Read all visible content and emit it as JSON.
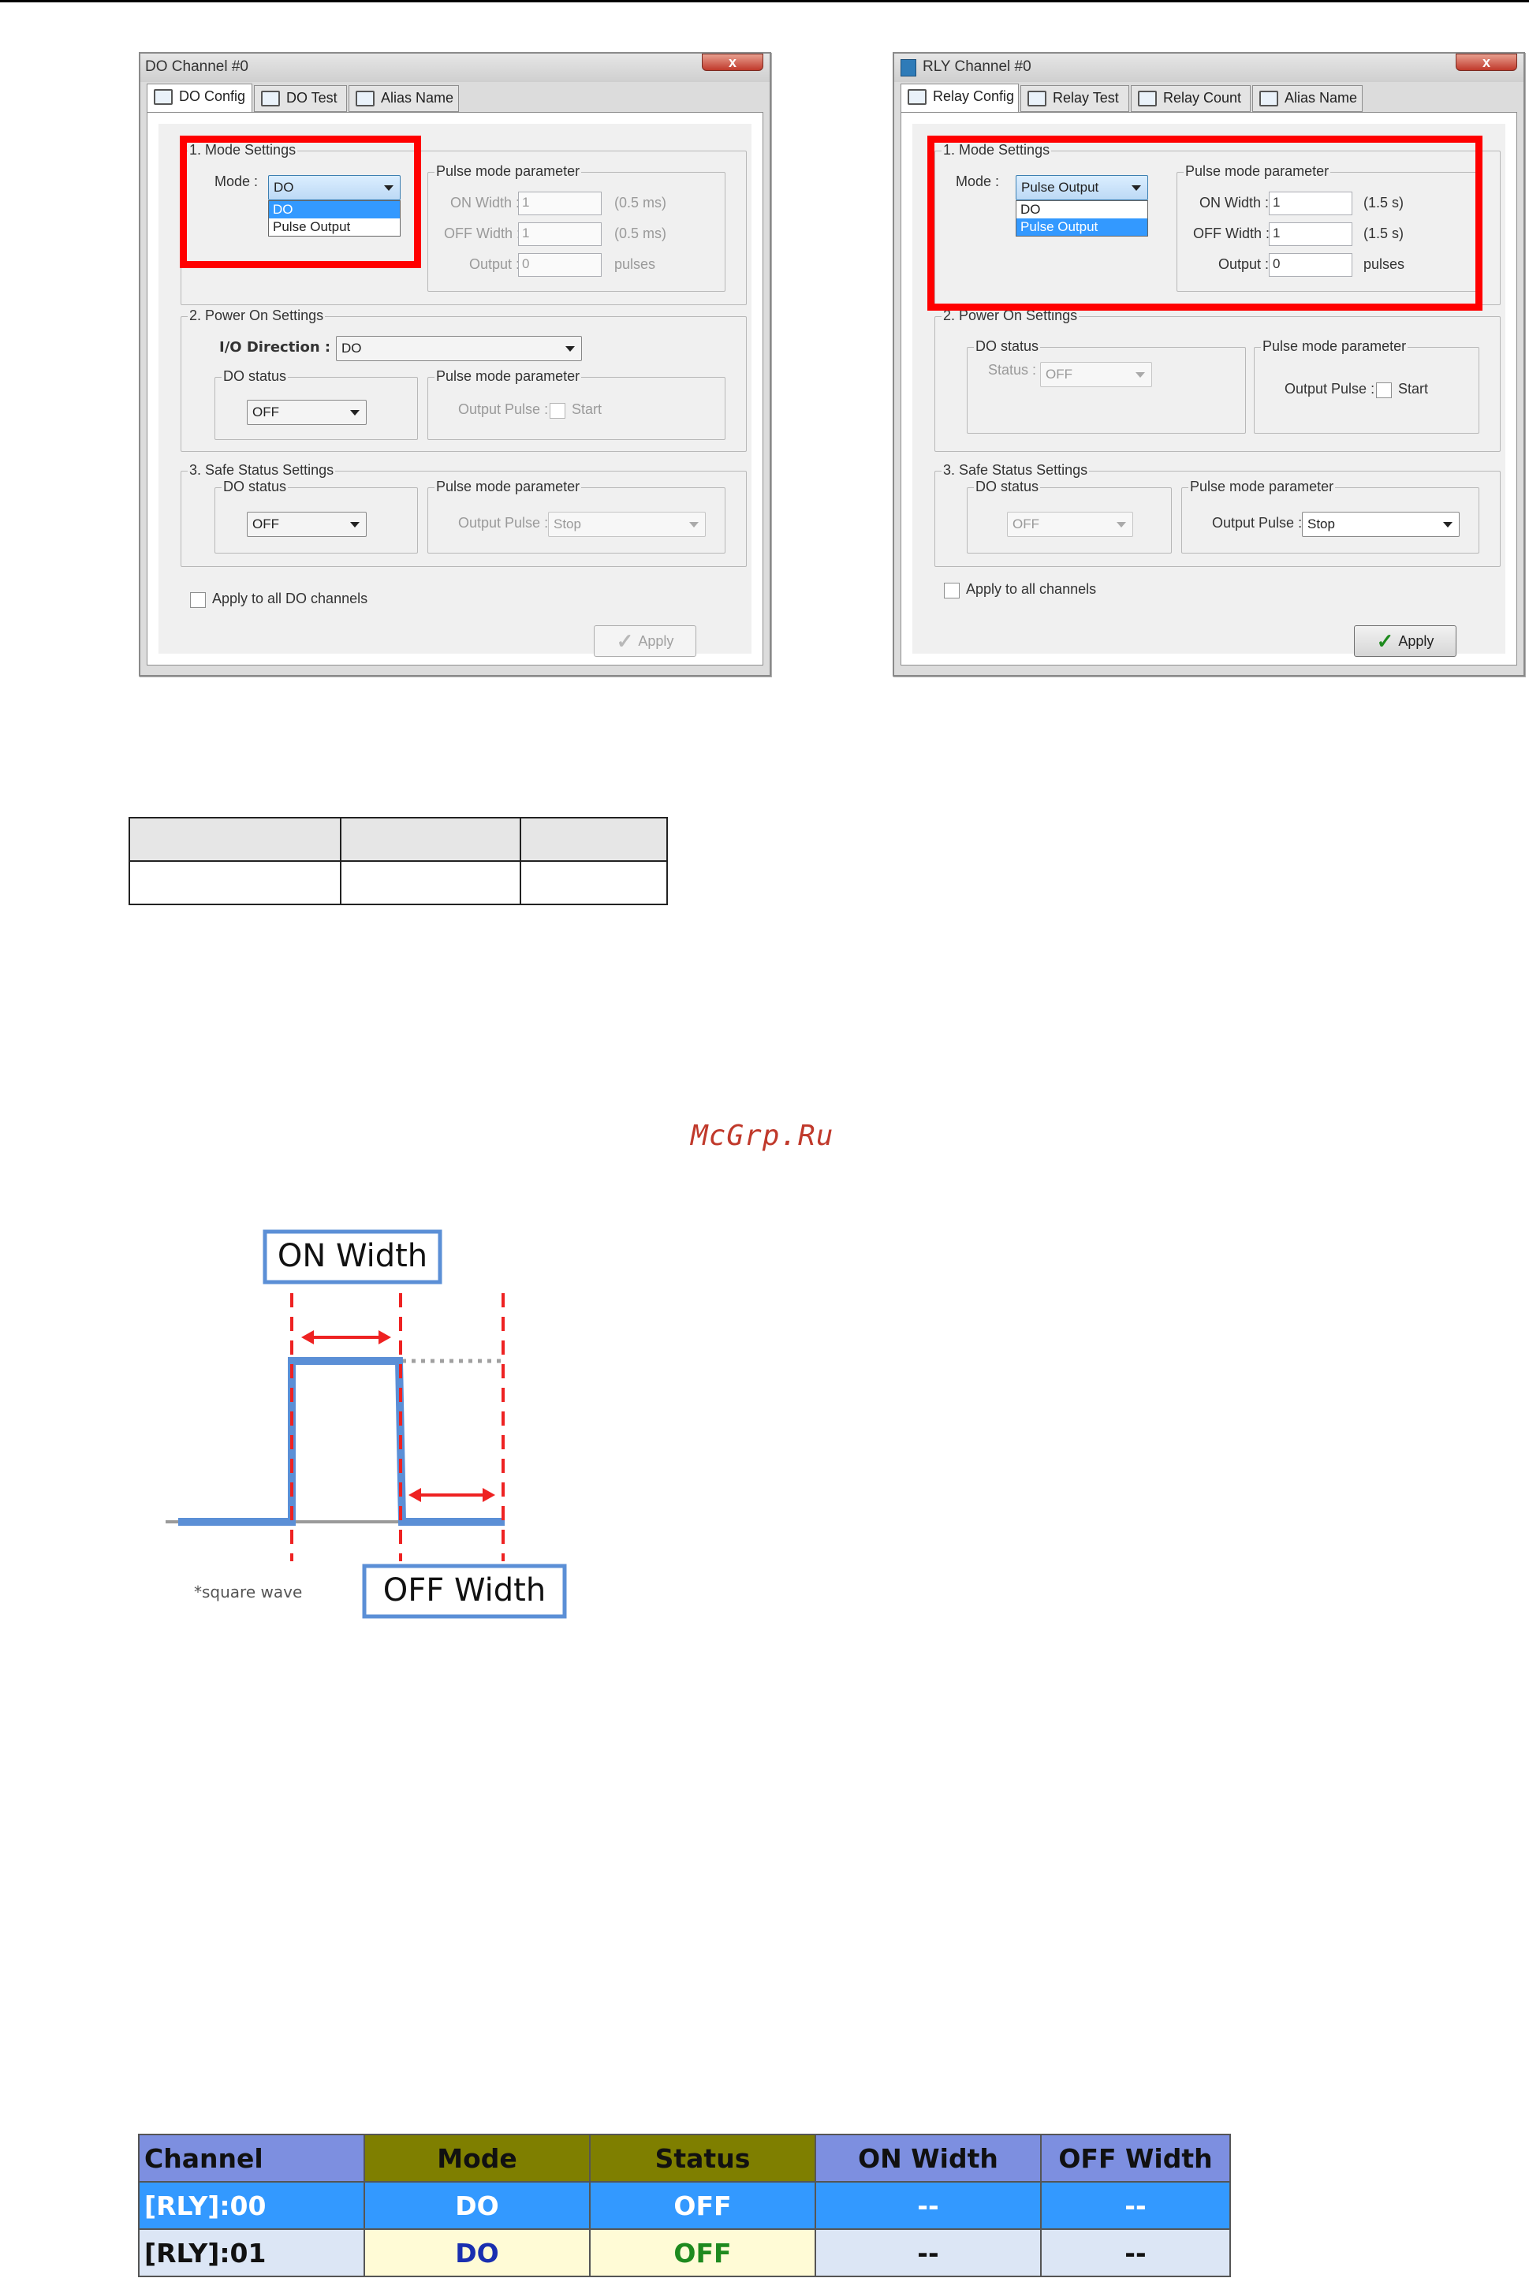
{
  "left_dialog": {
    "title": "DO Channel #0",
    "close_label": "x",
    "tabs": [
      "DO Config",
      "DO Test",
      "Alias Name"
    ],
    "mode_settings": {
      "legend": "1. Mode Settings",
      "mode_label": "Mode :",
      "mode_value": "DO",
      "options": [
        "DO",
        "Pulse Output"
      ]
    },
    "pulse_params": {
      "legend": "Pulse mode parameter",
      "on_width_label": "ON Width :",
      "on_width_value": "1",
      "on_width_unit": "(0.5 ms)",
      "off_width_label": "OFF Width :",
      "off_width_value": "1",
      "off_width_unit": "(0.5 ms)",
      "output_label": "Output :",
      "output_value": "0",
      "output_unit": "pulses"
    },
    "power_on": {
      "legend": "2. Power On Settings",
      "io_direction_label": "I/O Direction :",
      "io_direction_value": "DO",
      "do_status_legend": "DO status",
      "do_status_value": "OFF",
      "pulse_legend": "Pulse mode parameter",
      "output_pulse_label": "Output Pulse :",
      "start_label": "Start"
    },
    "safe_status": {
      "legend": "3. Safe Status Settings",
      "do_status_legend": "DO status",
      "do_status_value": "OFF",
      "pulse_legend": "Pulse mode parameter",
      "output_pulse_label": "Output Pulse :",
      "output_pulse_value": "Stop"
    },
    "apply_all_label": "Apply to all DO channels",
    "apply_label": "Apply"
  },
  "right_dialog": {
    "title": "RLY Channel #0",
    "close_label": "x",
    "tabs": [
      "Relay Config",
      "Relay Test",
      "Relay Count",
      "Alias Name"
    ],
    "mode_settings": {
      "legend": "1. Mode Settings",
      "mode_label": "Mode :",
      "mode_value": "Pulse Output",
      "options": [
        "DO",
        "Pulse Output"
      ]
    },
    "pulse_params": {
      "legend": "Pulse mode parameter",
      "on_width_label": "ON Width :",
      "on_width_value": "1",
      "on_width_unit": "(1.5 s)",
      "off_width_label": "OFF Width :",
      "off_width_value": "1",
      "off_width_unit": "(1.5 s)",
      "output_label": "Output :",
      "output_value": "0",
      "output_unit": "pulses"
    },
    "power_on": {
      "legend": "2. Power On Settings",
      "do_status_legend": "DO status",
      "status_label": "Status :",
      "status_value": "OFF",
      "pulse_legend": "Pulse mode parameter",
      "output_pulse_label": "Output Pulse :",
      "start_label": "Start"
    },
    "safe_status": {
      "legend": "3. Safe Status Settings",
      "do_status_legend": "DO status",
      "do_status_value": "OFF",
      "pulse_legend": "Pulse mode parameter",
      "output_pulse_label": "Output Pulse :",
      "output_pulse_value": "Stop"
    },
    "apply_all_label": "Apply to all channels",
    "apply_label": "Apply"
  },
  "watermark": "McGrp.Ru",
  "wave_diagram": {
    "on_width_label": "ON Width",
    "off_width_label": "OFF Width",
    "note": "*square wave"
  },
  "status_table": {
    "headers": [
      "Channel",
      "Mode",
      "Status",
      "ON Width",
      "OFF Width"
    ],
    "header_colors": [
      "#7d8fe0",
      "#7f7f00",
      "#7f7f00",
      "#7d8fe0",
      "#7d8fe0"
    ],
    "rows": [
      {
        "channel": "[RLY]:00",
        "mode": "DO",
        "status": "OFF",
        "on_width": "--",
        "off_width": "--",
        "selected": true
      },
      {
        "channel": "[RLY]:01",
        "mode": "DO",
        "status": "OFF",
        "on_width": "--",
        "off_width": "--",
        "selected": false
      }
    ]
  }
}
